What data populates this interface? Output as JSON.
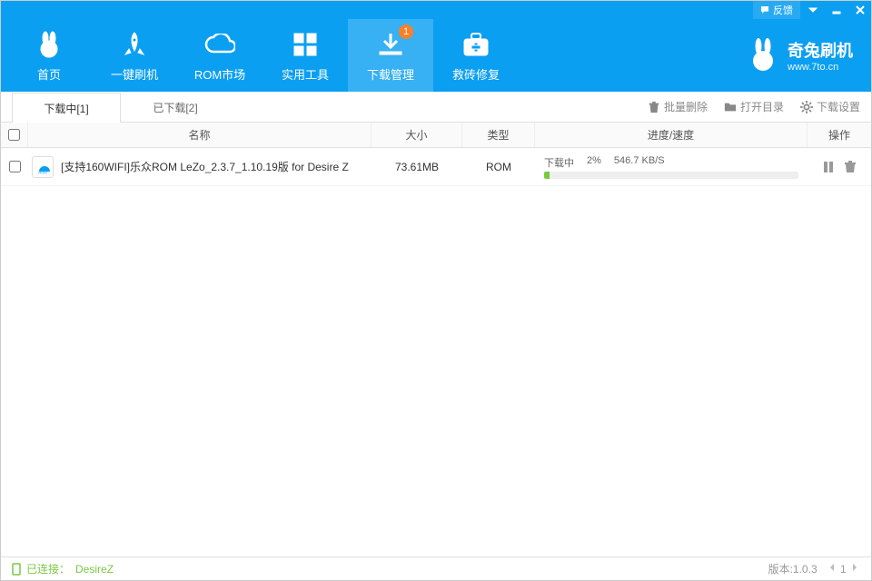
{
  "titlebar": {
    "feedback": "反馈"
  },
  "nav": {
    "items": [
      {
        "label": "首页"
      },
      {
        "label": "一键刷机"
      },
      {
        "label": "ROM市场"
      },
      {
        "label": "实用工具"
      },
      {
        "label": "下载管理",
        "badge": "1"
      },
      {
        "label": "救砖修复"
      }
    ]
  },
  "brand": {
    "cn": "奇兔刷机",
    "en": "www.7to.cn"
  },
  "tabs": {
    "downloading": "下载中[1]",
    "downloaded": "已下载[2]"
  },
  "subactions": {
    "batch_delete": "批量删除",
    "open_folder": "打开目录",
    "download_settings": "下载设置"
  },
  "columns": {
    "name": "名称",
    "size": "大小",
    "type": "类型",
    "progress": "进度/速度",
    "ops": "操作"
  },
  "rows": [
    {
      "name": "[支持160WIFI]乐众ROM LeZo_2.3.7_1.10.19版 for Desire Z",
      "size": "73.61MB",
      "type": "ROM",
      "status": "下载中",
      "percent_label": "2%",
      "percent": 2,
      "speed": "546.7 KB/S"
    }
  ],
  "status": {
    "connected_label": "已连接：",
    "device": "DesireZ",
    "version": "版本:1.0.3",
    "page": "1"
  }
}
